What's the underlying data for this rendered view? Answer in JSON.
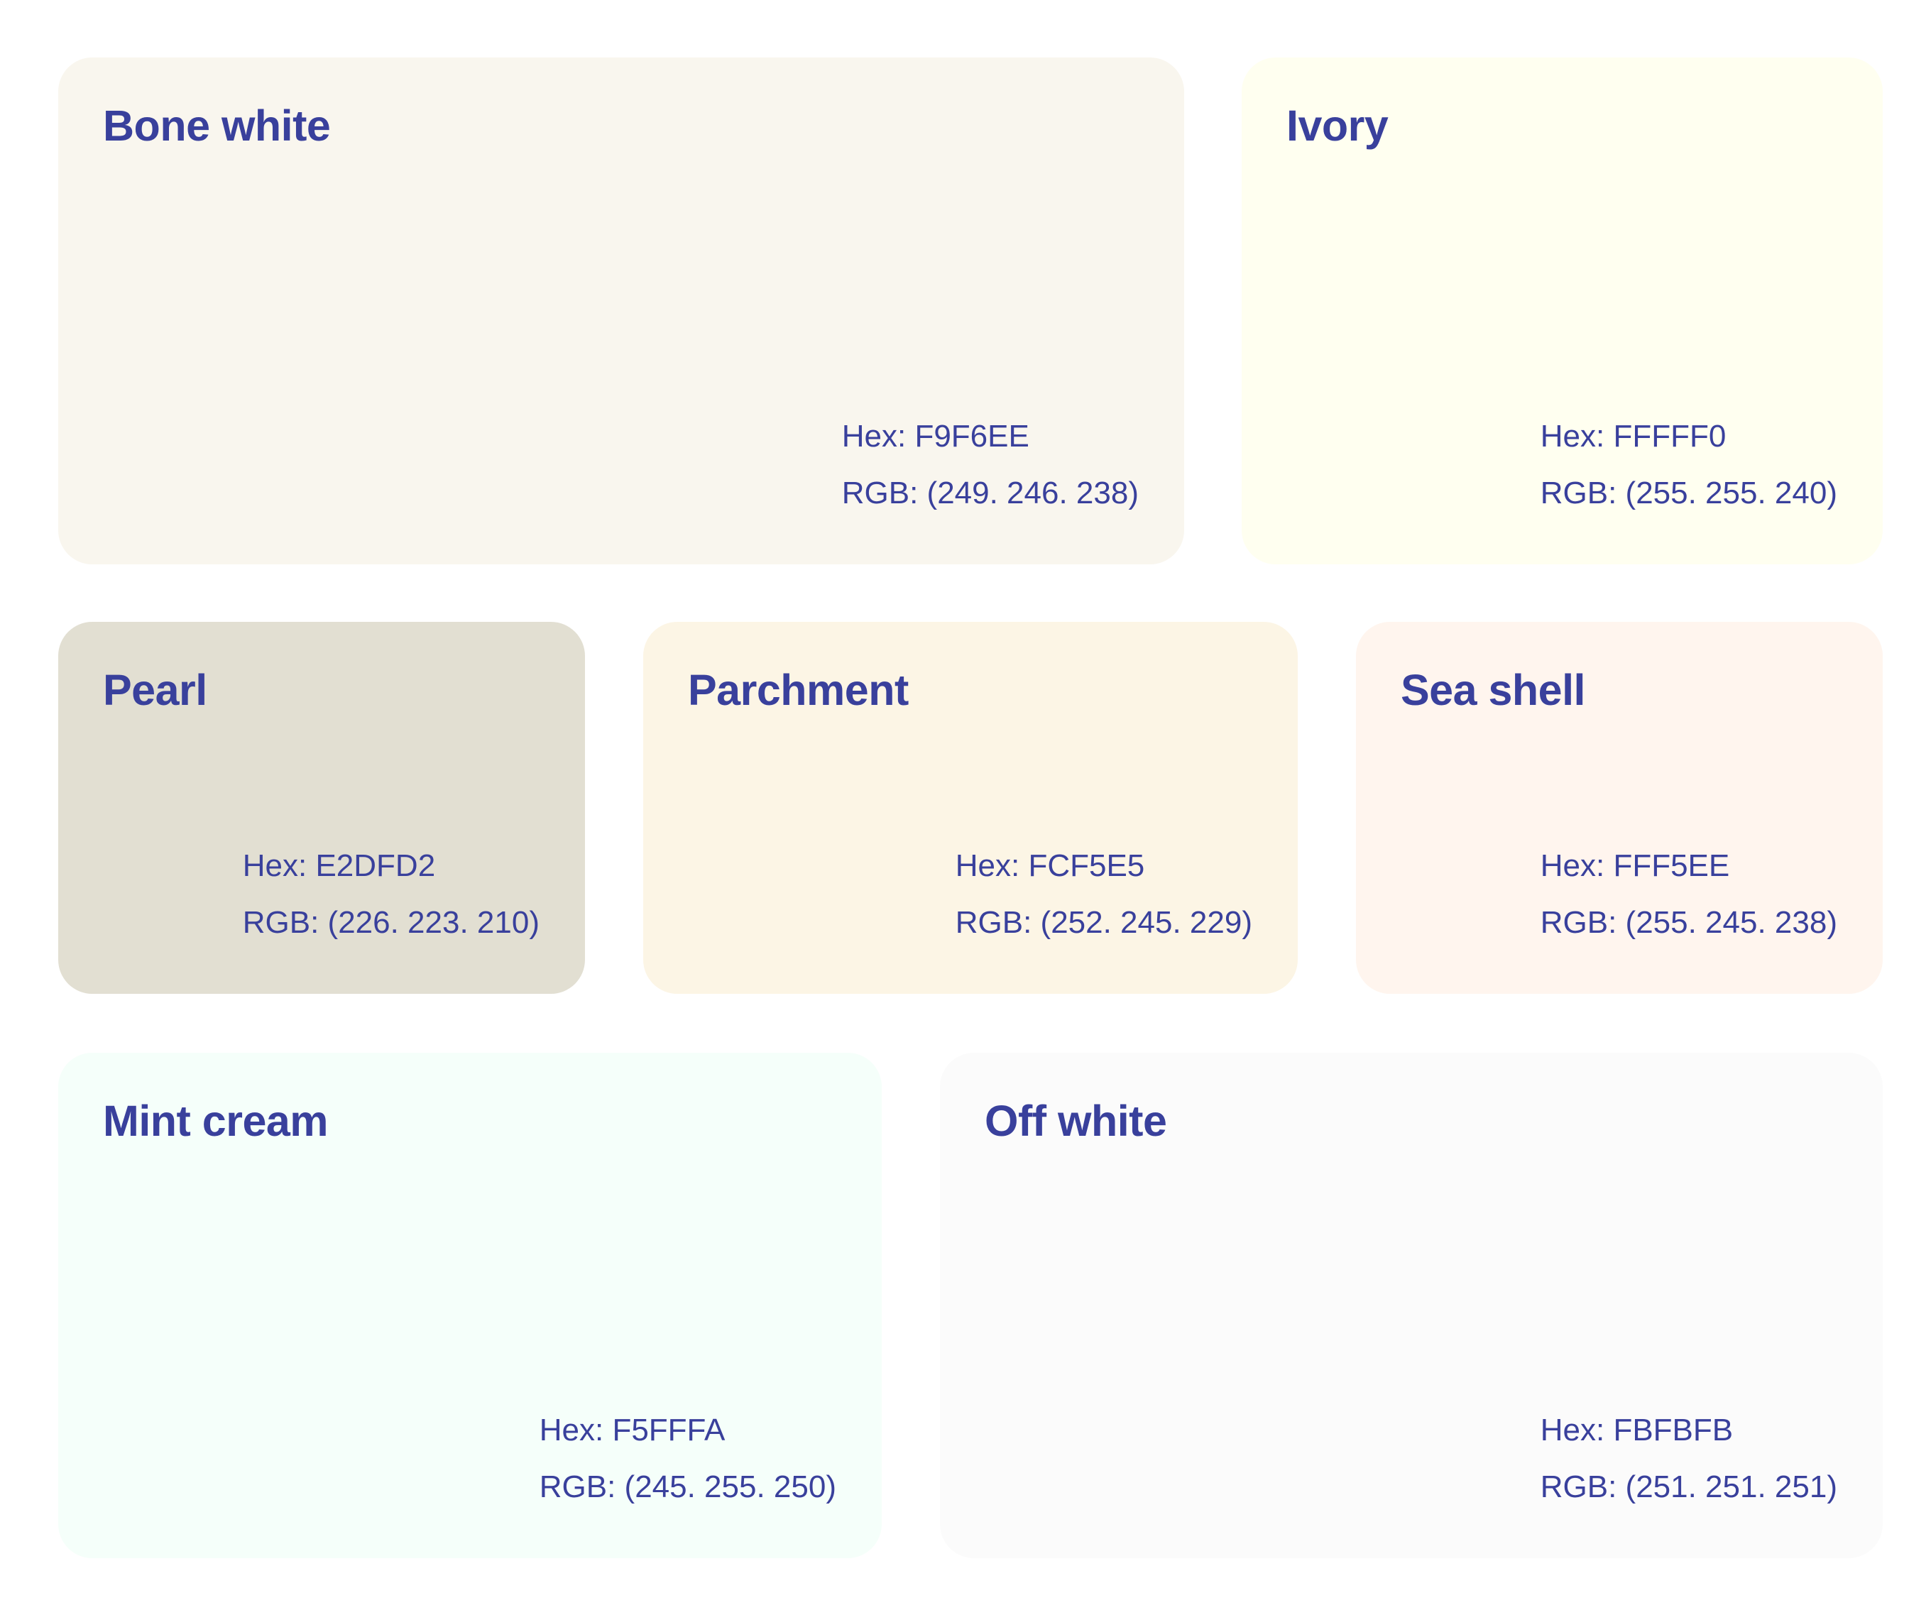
{
  "swatches": [
    {
      "name": "Bone white",
      "hex_label": "Hex: F9F6EE",
      "rgb_label": "RGB: (249. 246. 238)",
      "color": "#F9F6EE"
    },
    {
      "name": "Ivory",
      "hex_label": "Hex: FFFFF0",
      "rgb_label": "RGB: (255. 255. 240)",
      "color": "#FFFFF0"
    },
    {
      "name": "Pearl",
      "hex_label": "Hex: E2DFD2",
      "rgb_label": "RGB: (226. 223. 210)",
      "color": "#E2DFD2"
    },
    {
      "name": "Parchment",
      "hex_label": "Hex: FCF5E5",
      "rgb_label": "RGB: (252. 245. 229)",
      "color": "#FCF5E5"
    },
    {
      "name": "Sea shell",
      "hex_label": "Hex: FFF5EE",
      "rgb_label": "RGB: (255. 245. 238)",
      "color": "#FFF5EE"
    },
    {
      "name": "Mint cream",
      "hex_label": "Hex: F5FFFA",
      "rgb_label": "RGB: (245. 255. 250)",
      "color": "#F5FFFA"
    },
    {
      "name": "Off white",
      "hex_label": "Hex: FBFBFB",
      "rgb_label": "RGB: (251. 251. 251)",
      "color": "#FBFBFB"
    }
  ],
  "text_color": "#39409C",
  "background_color": "#FFFFFF"
}
